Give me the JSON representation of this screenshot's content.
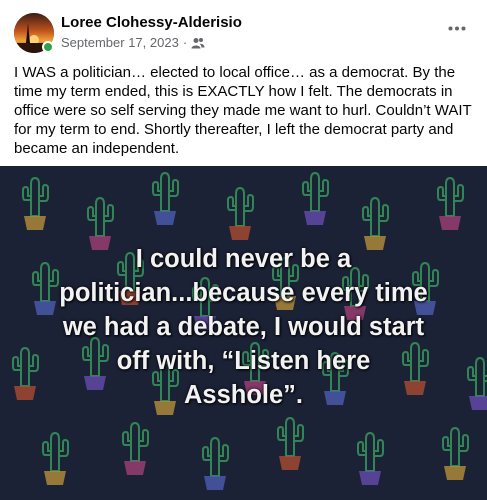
{
  "post": {
    "author": "Loree Clohessy-Alderisio",
    "date": "September 17, 2023",
    "separator": "·",
    "audience_icon": "friends-icon",
    "more_icon": "more-horizontal-icon",
    "body_text": "I WAS a politician… elected to local office… as a democrat.  By the time my term ended, this is EXACTLY how I felt.  The democrats in office were so self serving they made me want to hurl.  Couldn’t WAIT for my term to end.  Shortly thereafter, I left the democrat party and became an independent.",
    "image": {
      "quote_lines": [
        "I could never be a",
        "politician...because every time",
        "we had a debate, I would start",
        "off with, “Listen here",
        "Asshole”."
      ],
      "background_color": "#1c2236"
    }
  },
  "colors": {
    "online": "#31a24c",
    "secondary_text": "#65676b"
  }
}
